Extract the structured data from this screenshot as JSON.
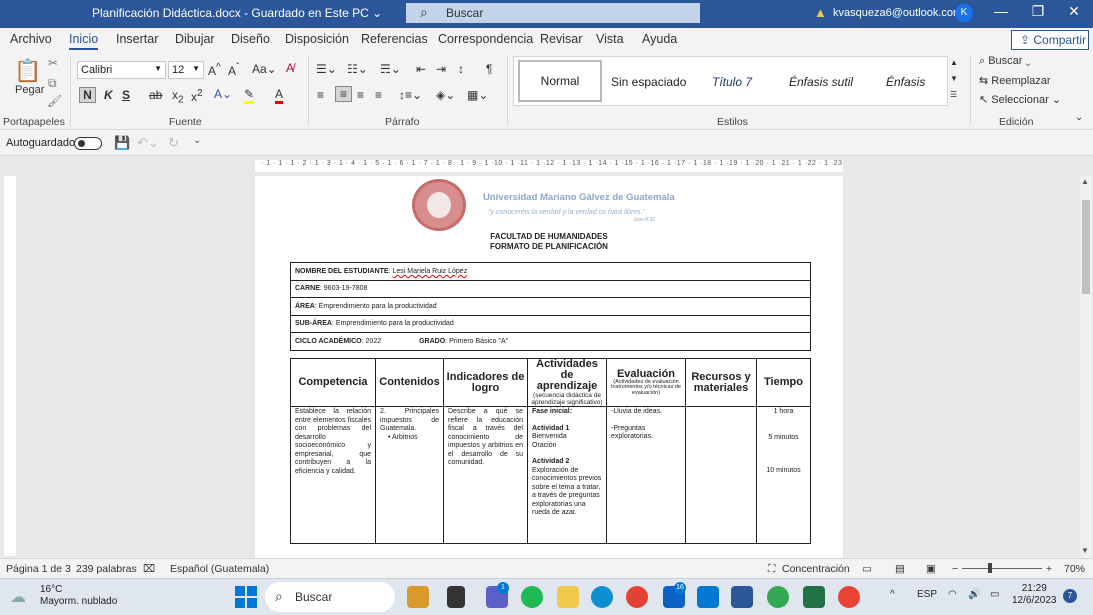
{
  "titlebar": {
    "title": "Planificación Didáctica.docx  -  Guardado en Este PC  ⌄",
    "search_placeholder": "Buscar",
    "account": "kvasqueza6@outlook.com",
    "avatar_letter": "K"
  },
  "menu": {
    "tabs": [
      "Archivo",
      "Inicio",
      "Insertar",
      "Dibujar",
      "Diseño",
      "Disposición",
      "Referencias",
      "Correspondencia",
      "Revisar",
      "Vista",
      "Ayuda"
    ],
    "share": "Compartir"
  },
  "ribbon": {
    "paste": "Pegar",
    "font_name": "Calibri",
    "font_size": "12",
    "groups": [
      "Portapapeles",
      "Fuente",
      "Párrafo",
      "Estilos",
      "Edición"
    ],
    "styles": [
      "Normal",
      "Sin espaciado",
      "Título 7",
      "Énfasis sutil",
      "Énfasis"
    ],
    "edit": {
      "find": "Buscar",
      "replace": "Reemplazar",
      "select": "Seleccionar"
    }
  },
  "qat": {
    "autosave": "Autoguardado"
  },
  "ruler_text": "· 1 · 1 · 1 · 2 · 1 · 3 · 1 · 4 · 1 · 5 · 1 · 6 · 1 · 7 · 1 · 8 · 1 · 9 · 1 ·10 · 1 ·11 · 1 ·12 · 1 ·13 · 1 ·14 · 1 ·15 · 1 ·16 · 1 ·17 · 1 ·18 · 1 ·19 · 1 ·20 · 1 ·21 · 1 ·22 · 1 ·23 · 1 ·24 · 1 ·25 · 1 ·26",
  "doc": {
    "university": "Universidad Mariano Gálvez de Guatemala",
    "motto": "\"y conoceréis la verdad y la verdad os hará libres.\"",
    "motto_ref": "Juan 8:32",
    "faculty": "FACULTAD DE HUMANIDADES",
    "format": "FORMATO DE PLANIFICACIÓN",
    "info": {
      "student_label": "NOMBRE DEL ESTUDIANTE",
      "student": "Lesi Mariela Ruiz López",
      "carne_label": "CARNE",
      "carne": "9603-19-7808",
      "area_label": "ÁREA",
      "area": "Emprendimiento para la productividad",
      "subarea_label": "SUB-ÁREA",
      "subarea": "Emprendimiento para la productividad",
      "ciclo_label": "CICLO ACADÉMICO",
      "ciclo": "2022",
      "grado_label": "GRADO",
      "grado": "Primero Básico \"A\""
    },
    "headers": {
      "competencia": "Competencia",
      "contenidos": "Contenidos",
      "indicadores": "Indicadores de logro",
      "actividades": "Actividades de aprendizaje",
      "actividades_sub": "(secuencia didáctica de aprendizaje significativo)",
      "evaluacion": "Evaluación",
      "evaluacion_sub": "(Actividades de evaluación Instrumentos y/o técnicas de evaluación)",
      "recursos": "Recursos y materiales",
      "tiempo": "Tiempo"
    },
    "row": {
      "competencia": "Establece la relación entre elementos fiscales con problemas del desarrollo socioeconómico y empresarial, que contribuyen a la eficiencia y calidad.",
      "contenidos": "2. Principales impuestos de Guatemala.",
      "contenidos_item": "• Arbitrios",
      "indicadores": "Describe a qué se refiere la educación fiscal a través del conocimiento de impuestos y arbitrios en el desarrollo de su comunidad.",
      "fase": "Fase inicial:",
      "act1_title": "Actividad 1",
      "act1_a": "Bienvenida",
      "act1_b": "Oración",
      "act2_title": "Actividad 2",
      "act2_text": "Exploración de conocimientos previos sobre el tema a tratar, a través de preguntas exploratorias una rueda de azar.",
      "eval1": "-Lluvia de ideas.",
      "eval2": "-Preguntas exploratorias.",
      "tiempo1": "1 hora",
      "tiempo2": "5 minutos",
      "tiempo3": "10 minutos"
    }
  },
  "status": {
    "page": "Página 1 de 3",
    "words": "239 palabras",
    "lang": "Español (Guatemala)",
    "focus": "Concentración",
    "zoom": "70%"
  },
  "taskbar": {
    "temp": "16°C",
    "weather": "Mayorm. nublado",
    "search": "Buscar",
    "lang": "ESP",
    "time": "21:29",
    "date": "12/6/2023",
    "notif": "7"
  }
}
